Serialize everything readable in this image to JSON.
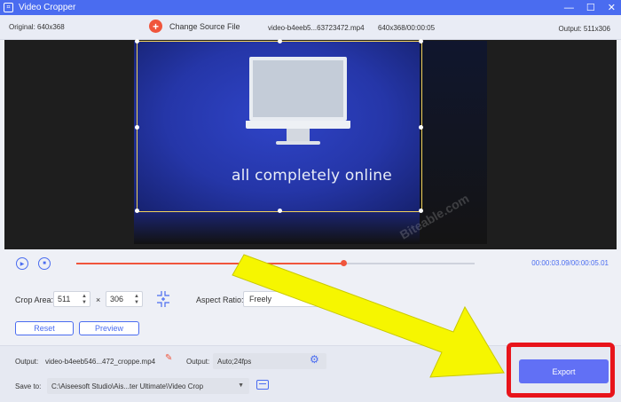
{
  "window": {
    "title": "Video Cropper",
    "icon": "crop-app-icon",
    "controls": [
      "—",
      "☐",
      "✕"
    ]
  },
  "infobar": {
    "original": "Original: 640x368",
    "change_source_label": "Change Source File",
    "filename": "video-b4eeb5...63723472.mp4",
    "dims_time": "640x368/00:00:05",
    "output": "Output: 511x306"
  },
  "preview": {
    "caption": "all completely online",
    "watermark": "Biteable.com"
  },
  "playback": {
    "progress": 0.67,
    "current_time": "00:00:03.09",
    "total_time": "/00:00:05.01"
  },
  "crop": {
    "label": "Crop Area:",
    "width": "511",
    "times": "×",
    "height": "306",
    "aspect_label": "Aspect Ratio:",
    "aspect_value": "Freely",
    "reset_label": "Reset",
    "preview_label": "Preview"
  },
  "output": {
    "label": "Output:",
    "filename": "video-b4eeb546...472_croppe.mp4",
    "settings_label": "Output:",
    "settings_value": "Auto;24fps",
    "save_label": "Save to:",
    "save_path": "C:\\Aiseesoft Studio\\Ais...ter Ultimate\\Video Crop",
    "export_label": "Export"
  },
  "colors": {
    "accent": "#4a6cf0",
    "export": "#6170f5",
    "highlight": "#e8141b",
    "progress": "#f0553c",
    "arrow": "#f6f600"
  }
}
